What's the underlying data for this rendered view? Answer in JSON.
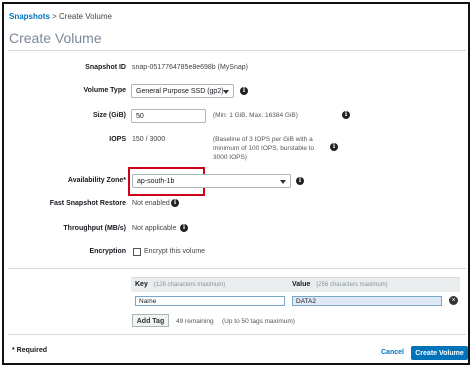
{
  "breadcrumb": {
    "link": "Snapshots",
    "separator": " > ",
    "current": "Create Volume"
  },
  "page_title": "Create Volume",
  "form": {
    "snapshot_id": {
      "label": "Snapshot ID",
      "value": "snap-0517764785e8e698b (MySnap)"
    },
    "volume_type": {
      "label": "Volume Type",
      "value": "General Purpose SSD (gp2)"
    },
    "size": {
      "label": "Size (GiB)",
      "value": "50",
      "hint": "(Min: 1 GiB, Max: 16384 GiB)"
    },
    "iops": {
      "label": "IOPS",
      "value": "150 / 3000",
      "hint": "(Baseline of 3 IOPS per GiB with a minimum of 100 IOPS, burstable to 3000 IOPS)"
    },
    "availability_zone": {
      "label": "Availability Zone*",
      "value": "ap-south-1b"
    },
    "fast_snapshot_restore": {
      "label": "Fast Snapshot Restore",
      "value": "Not enabled"
    },
    "throughput": {
      "label": "Throughput (MB/s)",
      "value": "Not applicable"
    },
    "encryption": {
      "label": "Encryption",
      "checkbox_label": "Encrypt this volume",
      "checked": false
    }
  },
  "tags": {
    "key_header": "Key",
    "key_hint": "(128 characters maximum)",
    "value_header": "Value",
    "value_hint": "(256 characters maximum)",
    "rows": [
      {
        "key": "Name",
        "value": "DATA2"
      }
    ],
    "add_tag_label": "Add Tag",
    "remaining": "49 remaining",
    "max_hint": "(Up to 50 tags maximum)"
  },
  "footer": {
    "required_note": "* Required",
    "cancel_label": "Cancel",
    "create_label": "Create Volume"
  },
  "colors": {
    "link": "#0073bb",
    "primary": "#0073bb",
    "highlight_box": "#d0021b"
  }
}
